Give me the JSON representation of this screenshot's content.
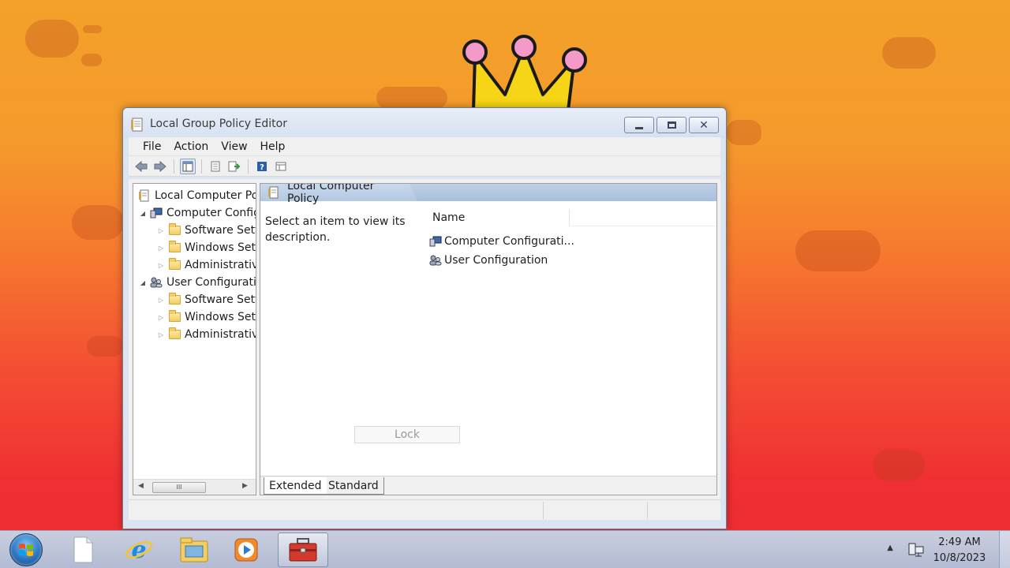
{
  "window": {
    "title": "Local Group Policy Editor",
    "minimize_label": "minimize",
    "maximize_label": "maximize",
    "close_label": "close"
  },
  "menubar": {
    "items": [
      {
        "label": "File"
      },
      {
        "label": "Action"
      },
      {
        "label": "View"
      },
      {
        "label": "Help"
      }
    ]
  },
  "toolbar": {
    "buttons": [
      "back-icon",
      "forward-icon",
      "show-hide-tree-icon",
      "properties-icon",
      "export-list-icon",
      "help-icon",
      "view-icon"
    ]
  },
  "tree": {
    "items": [
      {
        "label": "Local Computer Policy",
        "level": 0,
        "icon": "policy-doc-icon"
      },
      {
        "label": "Computer Configuration",
        "level": 1,
        "icon": "computer-icon",
        "expanded": true
      },
      {
        "label": "Software Settings",
        "level": 2,
        "icon": "folder-icon"
      },
      {
        "label": "Windows Settings",
        "level": 2,
        "icon": "folder-icon"
      },
      {
        "label": "Administrative Templates",
        "level": 2,
        "icon": "folder-icon"
      },
      {
        "label": "User Configuration",
        "level": 1,
        "icon": "users-icon",
        "expanded": true
      },
      {
        "label": "Software Settings",
        "level": 2,
        "icon": "folder-icon"
      },
      {
        "label": "Windows Settings",
        "level": 2,
        "icon": "folder-icon"
      },
      {
        "label": "Administrative Templates",
        "level": 2,
        "icon": "folder-icon"
      }
    ]
  },
  "details": {
    "header": "Local Computer Policy",
    "description": "Select an item to view its description.",
    "column_name": "Name",
    "items": [
      {
        "label": "Computer Configurati...",
        "icon": "computer-icon"
      },
      {
        "label": "User Configuration",
        "icon": "users-icon"
      }
    ],
    "tooltip": "Lock",
    "tabs": [
      {
        "label": "Extended",
        "active": true
      },
      {
        "label": "Standard",
        "active": false
      }
    ]
  },
  "taskbar": {
    "apps": [
      "start-orb",
      "notepad-icon",
      "internet-explorer-icon",
      "file-explorer-icon",
      "media-player-icon",
      "toolbox-icon"
    ],
    "active_app": "toolbox-icon",
    "time": "2:49 AM",
    "date": "10/8/2023"
  },
  "colors": {
    "wallpaper_top": "#f2a12a",
    "wallpaper_bottom": "#ee2c30",
    "header_blue": "#b3c8e1"
  }
}
